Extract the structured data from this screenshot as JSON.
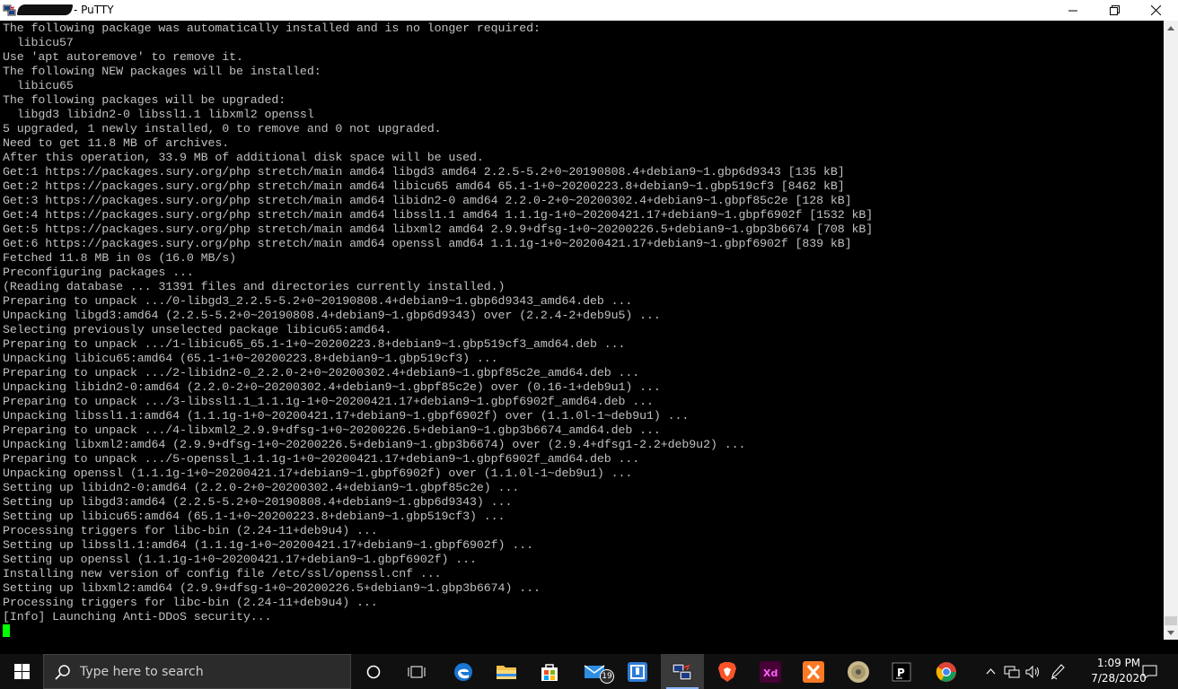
{
  "window": {
    "title": "- PuTTY",
    "controls": {
      "minimize": "—",
      "maximize": "❐",
      "close": "✕"
    }
  },
  "terminal": {
    "lines": [
      "The following package was automatically installed and is no longer required:",
      "  libicu57",
      "Use 'apt autoremove' to remove it.",
      "The following NEW packages will be installed:",
      "  libicu65",
      "The following packages will be upgraded:",
      "  libgd3 libidn2-0 libssl1.1 libxml2 openssl",
      "5 upgraded, 1 newly installed, 0 to remove and 0 not upgraded.",
      "Need to get 11.8 MB of archives.",
      "After this operation, 33.9 MB of additional disk space will be used.",
      "Get:1 https://packages.sury.org/php stretch/main amd64 libgd3 amd64 2.2.5-5.2+0~20190808.4+debian9~1.gbp6d9343 [135 kB]",
      "Get:2 https://packages.sury.org/php stretch/main amd64 libicu65 amd64 65.1-1+0~20200223.8+debian9~1.gbp519cf3 [8462 kB]",
      "Get:3 https://packages.sury.org/php stretch/main amd64 libidn2-0 amd64 2.2.0-2+0~20200302.4+debian9~1.gbpf85c2e [128 kB]",
      "Get:4 https://packages.sury.org/php stretch/main amd64 libssl1.1 amd64 1.1.1g-1+0~20200421.17+debian9~1.gbpf6902f [1532 kB]",
      "Get:5 https://packages.sury.org/php stretch/main amd64 libxml2 amd64 2.9.9+dfsg-1+0~20200226.5+debian9~1.gbp3b6674 [708 kB]",
      "Get:6 https://packages.sury.org/php stretch/main amd64 openssl amd64 1.1.1g-1+0~20200421.17+debian9~1.gbpf6902f [839 kB]",
      "Fetched 11.8 MB in 0s (16.0 MB/s)",
      "Preconfiguring packages ...",
      "(Reading database ... 31391 files and directories currently installed.)",
      "Preparing to unpack .../0-libgd3_2.2.5-5.2+0~20190808.4+debian9~1.gbp6d9343_amd64.deb ...",
      "Unpacking libgd3:amd64 (2.2.5-5.2+0~20190808.4+debian9~1.gbp6d9343) over (2.2.4-2+deb9u5) ...",
      "Selecting previously unselected package libicu65:amd64.",
      "Preparing to unpack .../1-libicu65_65.1-1+0~20200223.8+debian9~1.gbp519cf3_amd64.deb ...",
      "Unpacking libicu65:amd64 (65.1-1+0~20200223.8+debian9~1.gbp519cf3) ...",
      "Preparing to unpack .../2-libidn2-0_2.2.0-2+0~20200302.4+debian9~1.gbpf85c2e_amd64.deb ...",
      "Unpacking libidn2-0:amd64 (2.2.0-2+0~20200302.4+debian9~1.gbpf85c2e) over (0.16-1+deb9u1) ...",
      "Preparing to unpack .../3-libssl1.1_1.1.1g-1+0~20200421.17+debian9~1.gbpf6902f_amd64.deb ...",
      "Unpacking libssl1.1:amd64 (1.1.1g-1+0~20200421.17+debian9~1.gbpf6902f) over (1.1.0l-1~deb9u1) ...",
      "Preparing to unpack .../4-libxml2_2.9.9+dfsg-1+0~20200226.5+debian9~1.gbp3b6674_amd64.deb ...",
      "Unpacking libxml2:amd64 (2.9.9+dfsg-1+0~20200226.5+debian9~1.gbp3b6674) over (2.9.4+dfsg1-2.2+deb9u2) ...",
      "Preparing to unpack .../5-openssl_1.1.1g-1+0~20200421.17+debian9~1.gbpf6902f_amd64.deb ...",
      "Unpacking openssl (1.1.1g-1+0~20200421.17+debian9~1.gbpf6902f) over (1.1.0l-1~deb9u1) ...",
      "Setting up libidn2-0:amd64 (2.2.0-2+0~20200302.4+debian9~1.gbpf85c2e) ...",
      "Setting up libgd3:amd64 (2.2.5-5.2+0~20190808.4+debian9~1.gbp6d9343) ...",
      "Setting up libicu65:amd64 (65.1-1+0~20200223.8+debian9~1.gbp519cf3) ...",
      "Processing triggers for libc-bin (2.24-11+deb9u4) ...",
      "Setting up libssl1.1:amd64 (1.1.1g-1+0~20200421.17+debian9~1.gbpf6902f) ...",
      "Setting up openssl (1.1.1g-1+0~20200421.17+debian9~1.gbpf6902f) ...",
      "Installing new version of config file /etc/ssl/openssl.cnf ...",
      "Setting up libxml2:amd64 (2.9.9+dfsg-1+0~20200226.5+debian9~1.gbp3b6674) ...",
      "Processing triggers for libc-bin (2.24-11+deb9u4) ...",
      "[Info] Launching Anti-DDoS security..."
    ],
    "text_color": "#c0c0c0",
    "background": "#000000",
    "cursor_color": "#00ff00"
  },
  "taskbar": {
    "search_placeholder": "Type here to search",
    "pinned": [
      "cortana-icon",
      "task-view-icon",
      "edge-icon",
      "file-explorer-icon",
      "store-icon",
      "mail-icon",
      "terminal-app-icon",
      "putty-icon",
      "brave-icon",
      "adobe-xd-icon",
      "xampp-icon",
      "disc-app-icon",
      "phpstorm-icon",
      "chrome-icon"
    ],
    "mail_badge": "19",
    "clock": {
      "time": "1:09 PM",
      "date": "7/28/2020"
    },
    "accent": "#8ab4f8"
  }
}
